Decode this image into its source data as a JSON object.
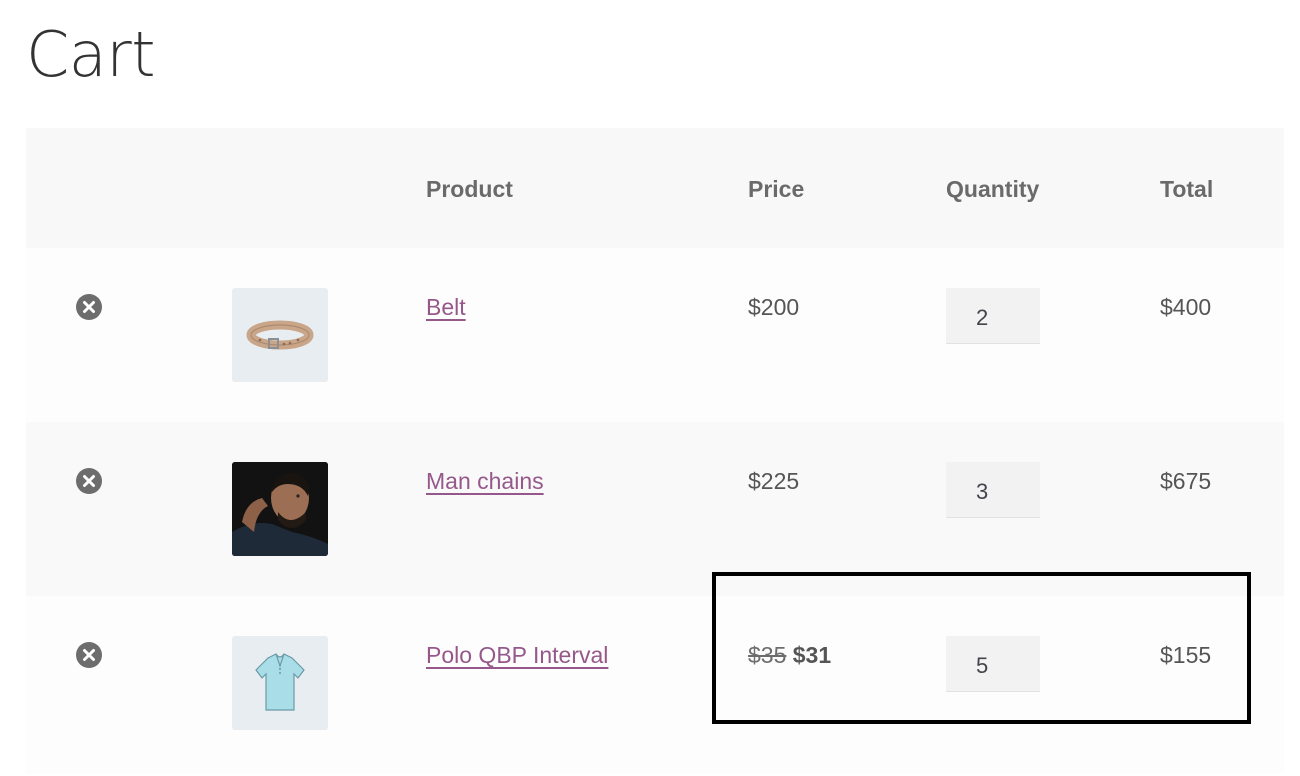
{
  "page": {
    "title": "Cart"
  },
  "table": {
    "headers": {
      "product": "Product",
      "price": "Price",
      "quantity": "Quantity",
      "total": "Total"
    }
  },
  "items": [
    {
      "name": "Belt",
      "price": "$200",
      "quantity": "2",
      "total": "$400",
      "image_icon": "belt-image"
    },
    {
      "name": "Man chains",
      "price": "$225",
      "quantity": "3",
      "total": "$675",
      "image_icon": "man-portrait-image"
    },
    {
      "name": "Polo QBP Interval",
      "price_original": "$35",
      "price_sale": "$31",
      "quantity": "5",
      "total": "$155",
      "image_icon": "polo-shirt-image"
    }
  ],
  "colors": {
    "link": "#96588a",
    "header_bg": "#f8f8f8",
    "remove_icon": "#6d6d6d",
    "highlight_border": "#000000"
  }
}
